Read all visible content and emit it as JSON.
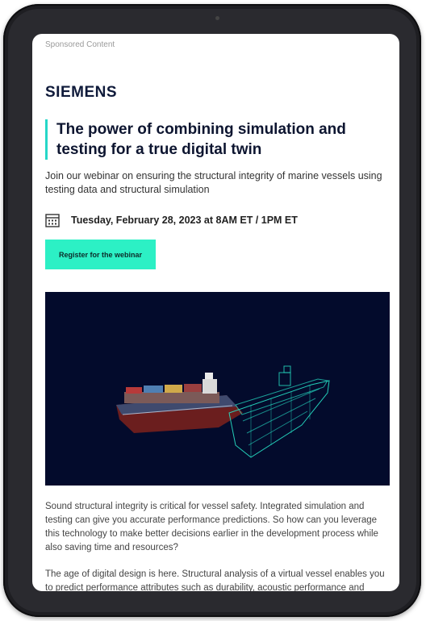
{
  "label": "Sponsored Content",
  "brand": "SIEMENS",
  "headline": "The power of combining simulation and testing for a true digital twin",
  "intro": "Join our webinar on ensuring the structural integrity of marine vessels using testing data and structural simulation",
  "event": {
    "icon": "calendar-icon",
    "date": "Tuesday, February 28, 2023 at 8AM ET / 1PM ET"
  },
  "cta": {
    "label": "Register for the webinar"
  },
  "body": {
    "paragraph1": "Sound structural integrity is critical for vessel safety. Integrated simulation and testing can give you accurate performance predictions. So how can you leverage this technology to make better decisions earlier in the development process while also saving time and resources?",
    "paragraph2": "The age of digital design is here. Structural analysis of a virtual vessel enables you to predict performance attributes such as durability, acoustic performance and"
  },
  "colors": {
    "accent": "#26d7c8",
    "button": "#2cf0c5",
    "hero_background": "#030b2c",
    "headline": "#0d1530"
  }
}
